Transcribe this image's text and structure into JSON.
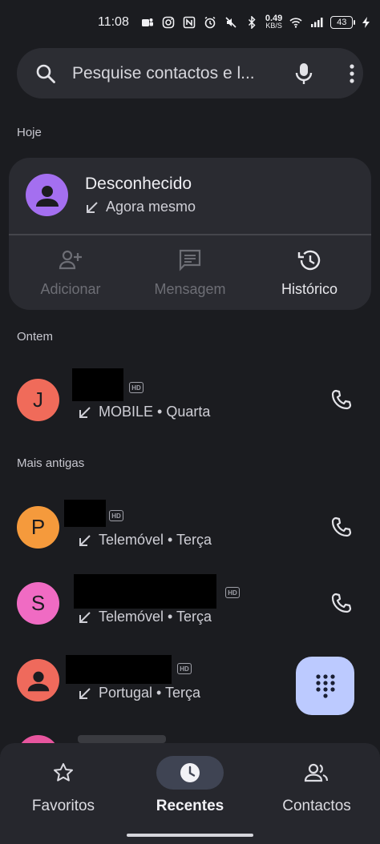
{
  "status_bar": {
    "time": "11:08",
    "net_speed_value": "0.49",
    "net_speed_unit": "KB/S",
    "battery": "43"
  },
  "search": {
    "placeholder": "Pesquise contactos e l..."
  },
  "sections": {
    "today": "Hoje",
    "yesterday": "Ontem",
    "older": "Mais antigas"
  },
  "expanded_call": {
    "name": "Desconhecido",
    "time": "Agora mesmo",
    "actions": [
      {
        "label": "Adicionar",
        "icon": "add-person-icon",
        "enabled": false
      },
      {
        "label": "Mensagem",
        "icon": "message-icon",
        "enabled": false
      },
      {
        "label": "Histórico",
        "icon": "history-icon",
        "enabled": true
      }
    ]
  },
  "calls": [
    {
      "initial": "J",
      "color": "#f06b5a",
      "detail": "MOBILE • Quarta"
    },
    {
      "initial": "P",
      "color": "#f59a3c",
      "detail": "Telemóvel • Terça"
    },
    {
      "initial": "S",
      "color": "#f06bc3",
      "detail": "Telemóvel • Terça"
    },
    {
      "initial": "",
      "color": "#ef6a5c",
      "detail": "Portugal • Terça"
    }
  ],
  "bottom_nav": {
    "favorites": "Favoritos",
    "recents": "Recentes",
    "contacts": "Contactos"
  },
  "colors": {
    "background": "#1b1c20",
    "card": "#2a2b31",
    "fab": "#bccaff",
    "nav_active_pill": "#3f4453",
    "unknown_avatar": "#a46ff0"
  }
}
